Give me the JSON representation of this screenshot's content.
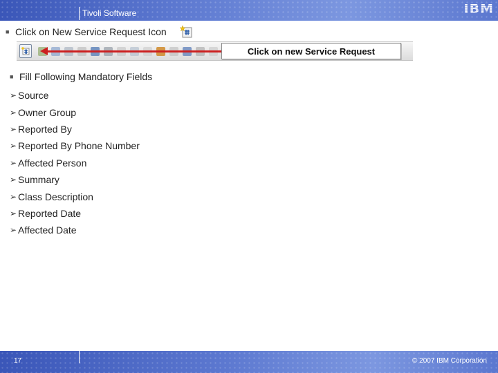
{
  "header": {
    "brand": "Tivoli Software",
    "logo": "IBM"
  },
  "steps": {
    "step1": "Click on New Service Request Icon",
    "step2": "Fill Following Mandatory  Fields"
  },
  "toolbar": {
    "callout": "Click on new Service Request",
    "icons": [
      "new-service-request-icon",
      "toolbar-icon",
      "toolbar-icon",
      "toolbar-icon",
      "toolbar-icon",
      "toolbar-icon",
      "toolbar-icon",
      "toolbar-icon",
      "toolbar-icon",
      "toolbar-icon",
      "toolbar-icon",
      "toolbar-icon",
      "toolbar-icon",
      "toolbar-icon",
      "toolbar-icon",
      "toolbar-icon",
      "toolbar-icon"
    ],
    "accent_color": "#cc1f1f"
  },
  "fields": [
    "Source",
    "Owner Group",
    "Reported By",
    "Reported By Phone Number",
    "Affected Person",
    "Summary",
    "Class Description",
    "Reported Date",
    "Affected Date"
  ],
  "footer": {
    "page_number": "17",
    "copyright": "© 2007 IBM Corporation"
  },
  "colors": {
    "band": "#5c78d0",
    "text": "#222222"
  }
}
